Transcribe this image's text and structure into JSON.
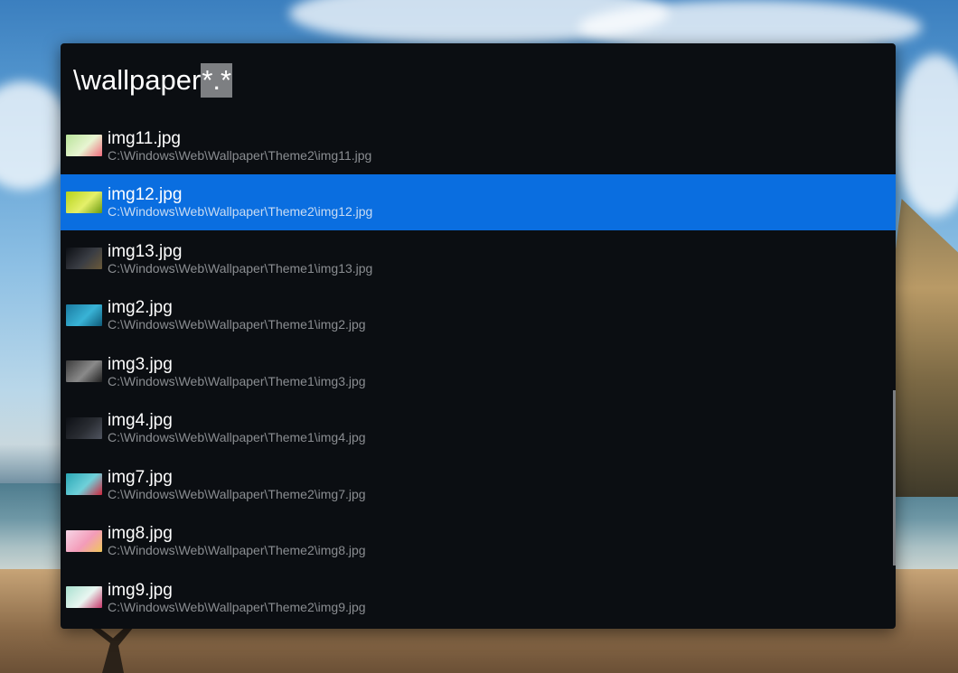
{
  "search": {
    "typed": "\\wallpaper",
    "selected_text": "*.*"
  },
  "results": [
    {
      "name": "img11.jpg",
      "path": "C:\\Windows\\Web\\Wallpaper\\Theme2\\img11.jpg",
      "thumb_colors": [
        "#b9e39a",
        "#e8f5d2",
        "#f06b7c"
      ],
      "selected": false
    },
    {
      "name": "img12.jpg",
      "path": "C:\\Windows\\Web\\Wallpaper\\Theme2\\img12.jpg",
      "thumb_colors": [
        "#b6d21a",
        "#e5f06a",
        "#6a9a10"
      ],
      "selected": true
    },
    {
      "name": "img13.jpg",
      "path": "C:\\Windows\\Web\\Wallpaper\\Theme1\\img13.jpg",
      "thumb_colors": [
        "#0c0f14",
        "#3a3d44",
        "#6b5a3a"
      ],
      "selected": false
    },
    {
      "name": "img2.jpg",
      "path": "C:\\Windows\\Web\\Wallpaper\\Theme1\\img2.jpg",
      "thumb_colors": [
        "#1a7aa0",
        "#39b3d6",
        "#0e5a78"
      ],
      "selected": false
    },
    {
      "name": "img3.jpg",
      "path": "C:\\Windows\\Web\\Wallpaper\\Theme1\\img3.jpg",
      "thumb_colors": [
        "#3c3c3c",
        "#8a8a8a",
        "#1f1f1f"
      ],
      "selected": false
    },
    {
      "name": "img4.jpg",
      "path": "C:\\Windows\\Web\\Wallpaper\\Theme1\\img4.jpg",
      "thumb_colors": [
        "#0c0f14",
        "#2a2d33",
        "#505560"
      ],
      "selected": false
    },
    {
      "name": "img7.jpg",
      "path": "C:\\Windows\\Web\\Wallpaper\\Theme2\\img7.jpg",
      "thumb_colors": [
        "#2aa7b5",
        "#6fd0d9",
        "#d1253c"
      ],
      "selected": false
    },
    {
      "name": "img8.jpg",
      "path": "C:\\Windows\\Web\\Wallpaper\\Theme2\\img8.jpg",
      "thumb_colors": [
        "#f6d6e6",
        "#f39cb9",
        "#f0c65a"
      ],
      "selected": false
    },
    {
      "name": "img9.jpg",
      "path": "C:\\Windows\\Web\\Wallpaper\\Theme2\\img9.jpg",
      "thumb_colors": [
        "#a9e0cf",
        "#e9f6f1",
        "#c7376a"
      ],
      "selected": false
    }
  ],
  "colors": {
    "panel_bg": "#0b0e12",
    "selection": "#0a6ee0",
    "path_text": "#8a8d91"
  }
}
